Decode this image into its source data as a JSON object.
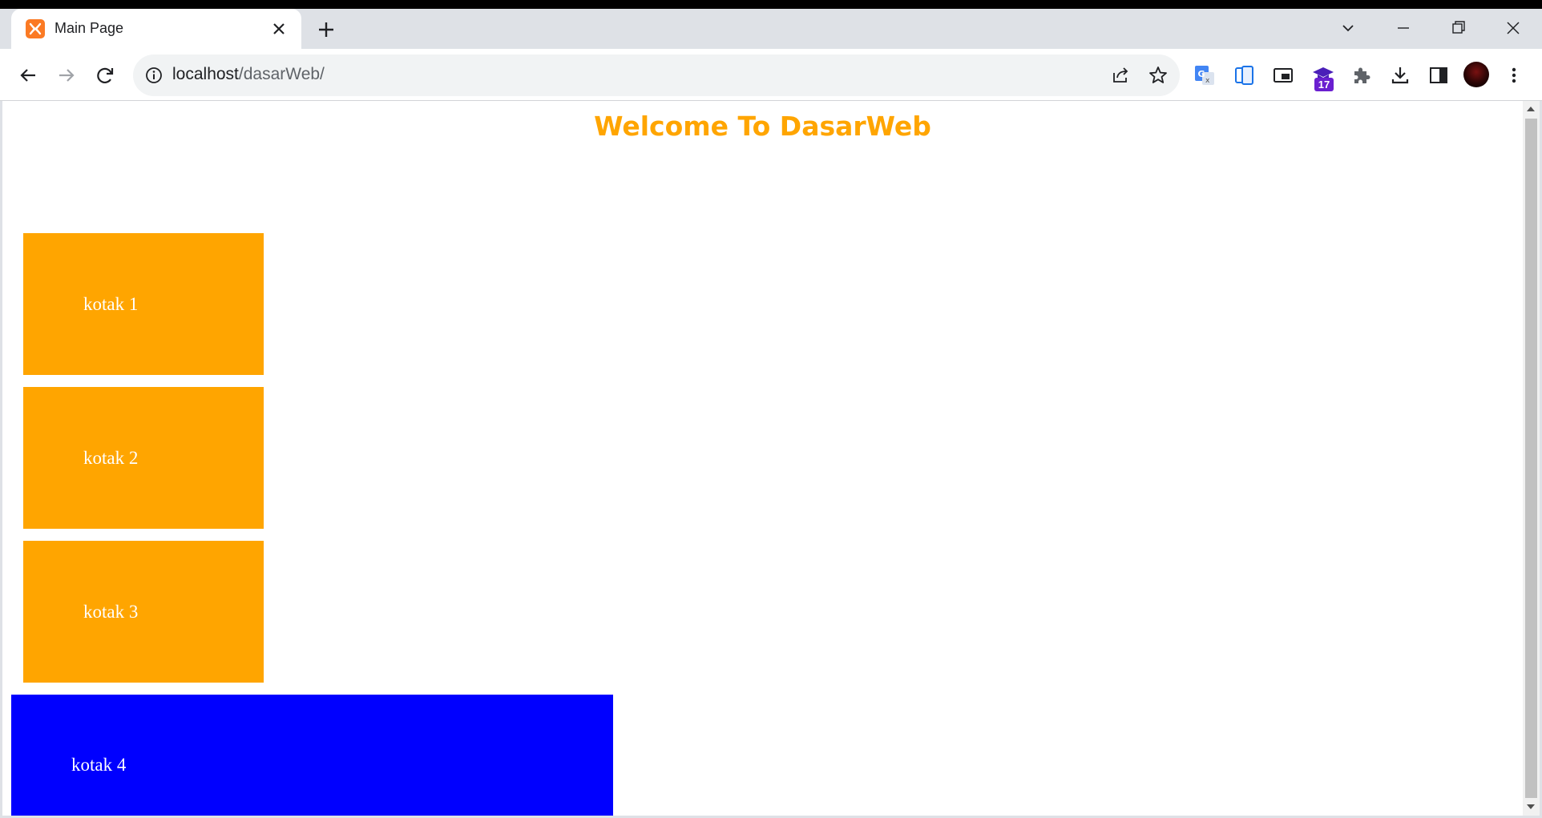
{
  "browser": {
    "tab": {
      "title": "Main Page"
    },
    "address_bar": {
      "host": "localhost",
      "path": "/dasarWeb/"
    },
    "extensions": {
      "badge_count": "17"
    }
  },
  "page": {
    "heading": "Welcome To DasarWeb",
    "boxes": [
      {
        "label": "kotak 1",
        "color": "#ffa500"
      },
      {
        "label": "kotak 2",
        "color": "#ffa500"
      },
      {
        "label": "kotak 3",
        "color": "#ffa500"
      },
      {
        "label": "kotak 4",
        "color": "#0000ff"
      }
    ]
  },
  "colors": {
    "accent": "#ffa500",
    "blue_box": "#0000ff",
    "tab_bar": "#dee1e6"
  }
}
